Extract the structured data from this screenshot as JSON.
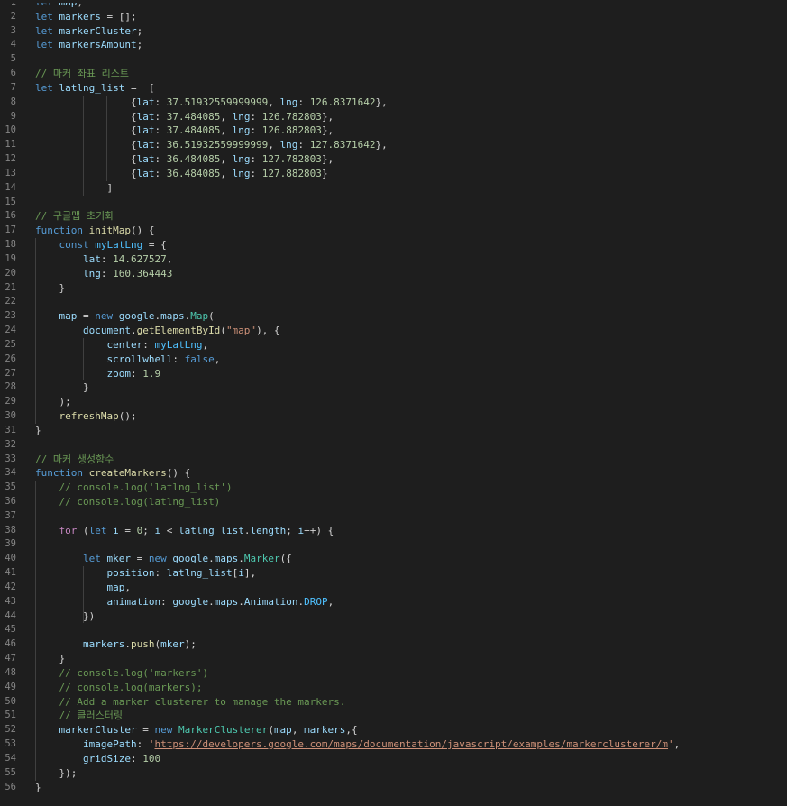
{
  "editor": {
    "language": "javascript",
    "theme": "dark",
    "first_line_number": 1,
    "lines": [
      [
        {
          "t": "let ",
          "c": "kw"
        },
        {
          "t": "map",
          "c": "var"
        },
        {
          "t": ";"
        }
      ],
      [
        {
          "t": "let ",
          "c": "kw"
        },
        {
          "t": "markers",
          "c": "var"
        },
        {
          "t": " = [];"
        }
      ],
      [
        {
          "t": "let ",
          "c": "kw"
        },
        {
          "t": "markerCluster",
          "c": "var"
        },
        {
          "t": ";"
        }
      ],
      [
        {
          "t": "let ",
          "c": "kw"
        },
        {
          "t": "markersAmount",
          "c": "var"
        },
        {
          "t": ";"
        }
      ],
      [],
      [
        {
          "t": "// 마커 좌표 리스트",
          "c": "cm"
        }
      ],
      [
        {
          "t": "let ",
          "c": "kw"
        },
        {
          "t": "latlng_list",
          "c": "var"
        },
        {
          "t": " =  ["
        }
      ],
      [
        {
          "t": "                {"
        },
        {
          "t": "lat",
          "c": "var"
        },
        {
          "t": ": "
        },
        {
          "t": "37.51932559999999",
          "c": "num"
        },
        {
          "t": ", "
        },
        {
          "t": "lng",
          "c": "var"
        },
        {
          "t": ": "
        },
        {
          "t": "126.8371642",
          "c": "num"
        },
        {
          "t": "},"
        }
      ],
      [
        {
          "t": "                {"
        },
        {
          "t": "lat",
          "c": "var"
        },
        {
          "t": ": "
        },
        {
          "t": "37.484085",
          "c": "num"
        },
        {
          "t": ", "
        },
        {
          "t": "lng",
          "c": "var"
        },
        {
          "t": ": "
        },
        {
          "t": "126.782803",
          "c": "num"
        },
        {
          "t": "},"
        }
      ],
      [
        {
          "t": "                {"
        },
        {
          "t": "lat",
          "c": "var"
        },
        {
          "t": ": "
        },
        {
          "t": "37.484085",
          "c": "num"
        },
        {
          "t": ", "
        },
        {
          "t": "lng",
          "c": "var"
        },
        {
          "t": ": "
        },
        {
          "t": "126.882803",
          "c": "num"
        },
        {
          "t": "},"
        }
      ],
      [
        {
          "t": "                {"
        },
        {
          "t": "lat",
          "c": "var"
        },
        {
          "t": ": "
        },
        {
          "t": "36.51932559999999",
          "c": "num"
        },
        {
          "t": ", "
        },
        {
          "t": "lng",
          "c": "var"
        },
        {
          "t": ": "
        },
        {
          "t": "127.8371642",
          "c": "num"
        },
        {
          "t": "},"
        }
      ],
      [
        {
          "t": "                {"
        },
        {
          "t": "lat",
          "c": "var"
        },
        {
          "t": ": "
        },
        {
          "t": "36.484085",
          "c": "num"
        },
        {
          "t": ", "
        },
        {
          "t": "lng",
          "c": "var"
        },
        {
          "t": ": "
        },
        {
          "t": "127.782803",
          "c": "num"
        },
        {
          "t": "},"
        }
      ],
      [
        {
          "t": "                {"
        },
        {
          "t": "lat",
          "c": "var"
        },
        {
          "t": ": "
        },
        {
          "t": "36.484085",
          "c": "num"
        },
        {
          "t": ", "
        },
        {
          "t": "lng",
          "c": "var"
        },
        {
          "t": ": "
        },
        {
          "t": "127.882803",
          "c": "num"
        },
        {
          "t": "}"
        }
      ],
      [
        {
          "t": "            ]"
        }
      ],
      [],
      [
        {
          "t": "// 구글맵 초기화",
          "c": "cm"
        }
      ],
      [
        {
          "t": "function ",
          "c": "kw"
        },
        {
          "t": "initMap",
          "c": "fn"
        },
        {
          "t": "() {"
        }
      ],
      [
        {
          "t": "    "
        },
        {
          "t": "const ",
          "c": "kw"
        },
        {
          "t": "myLatLng",
          "c": "const"
        },
        {
          "t": " = {"
        }
      ],
      [
        {
          "t": "        "
        },
        {
          "t": "lat",
          "c": "var"
        },
        {
          "t": ": "
        },
        {
          "t": "14.627527",
          "c": "num"
        },
        {
          "t": ","
        }
      ],
      [
        {
          "t": "        "
        },
        {
          "t": "lng",
          "c": "var"
        },
        {
          "t": ": "
        },
        {
          "t": "160.364443",
          "c": "num"
        }
      ],
      [
        {
          "t": "    }"
        }
      ],
      [],
      [
        {
          "t": "    "
        },
        {
          "t": "map",
          "c": "var"
        },
        {
          "t": " = "
        },
        {
          "t": "new ",
          "c": "kw"
        },
        {
          "t": "google",
          "c": "var"
        },
        {
          "t": "."
        },
        {
          "t": "maps",
          "c": "var"
        },
        {
          "t": "."
        },
        {
          "t": "Map",
          "c": "cls"
        },
        {
          "t": "("
        }
      ],
      [
        {
          "t": "        "
        },
        {
          "t": "document",
          "c": "var"
        },
        {
          "t": "."
        },
        {
          "t": "getElementById",
          "c": "fn"
        },
        {
          "t": "("
        },
        {
          "t": "\"map\"",
          "c": "str"
        },
        {
          "t": "), {"
        }
      ],
      [
        {
          "t": "            "
        },
        {
          "t": "center",
          "c": "var"
        },
        {
          "t": ": "
        },
        {
          "t": "myLatLng",
          "c": "const"
        },
        {
          "t": ","
        }
      ],
      [
        {
          "t": "            "
        },
        {
          "t": "scrollwhell",
          "c": "var"
        },
        {
          "t": ": "
        },
        {
          "t": "false",
          "c": "kw"
        },
        {
          "t": ","
        }
      ],
      [
        {
          "t": "            "
        },
        {
          "t": "zoom",
          "c": "var"
        },
        {
          "t": ": "
        },
        {
          "t": "1.9",
          "c": "num"
        }
      ],
      [
        {
          "t": "        }"
        }
      ],
      [
        {
          "t": "    );"
        }
      ],
      [
        {
          "t": "    "
        },
        {
          "t": "refreshMap",
          "c": "fn"
        },
        {
          "t": "();"
        }
      ],
      [
        {
          "t": "}"
        }
      ],
      [],
      [
        {
          "t": "// 마커 생성함수",
          "c": "cm"
        }
      ],
      [
        {
          "t": "function ",
          "c": "kw"
        },
        {
          "t": "createMarkers",
          "c": "fn"
        },
        {
          "t": "() {"
        }
      ],
      [
        {
          "t": "    "
        },
        {
          "t": "// console.log('latlng_list')",
          "c": "cm"
        }
      ],
      [
        {
          "t": "    "
        },
        {
          "t": "// console.log(latlng_list)",
          "c": "cm"
        }
      ],
      [],
      [
        {
          "t": "    "
        },
        {
          "t": "for ",
          "c": "ctl"
        },
        {
          "t": "("
        },
        {
          "t": "let ",
          "c": "kw"
        },
        {
          "t": "i",
          "c": "var"
        },
        {
          "t": " = "
        },
        {
          "t": "0",
          "c": "num"
        },
        {
          "t": "; "
        },
        {
          "t": "i",
          "c": "var"
        },
        {
          "t": " < "
        },
        {
          "t": "latlng_list",
          "c": "var"
        },
        {
          "t": "."
        },
        {
          "t": "length",
          "c": "var"
        },
        {
          "t": "; "
        },
        {
          "t": "i",
          "c": "var"
        },
        {
          "t": "++) {"
        }
      ],
      [],
      [
        {
          "t": "        "
        },
        {
          "t": "let ",
          "c": "kw"
        },
        {
          "t": "mker",
          "c": "var"
        },
        {
          "t": " = "
        },
        {
          "t": "new ",
          "c": "kw"
        },
        {
          "t": "google",
          "c": "var"
        },
        {
          "t": "."
        },
        {
          "t": "maps",
          "c": "var"
        },
        {
          "t": "."
        },
        {
          "t": "Marker",
          "c": "cls"
        },
        {
          "t": "({"
        }
      ],
      [
        {
          "t": "            "
        },
        {
          "t": "position",
          "c": "var"
        },
        {
          "t": ": "
        },
        {
          "t": "latlng_list",
          "c": "var"
        },
        {
          "t": "["
        },
        {
          "t": "i",
          "c": "var"
        },
        {
          "t": "],"
        }
      ],
      [
        {
          "t": "            "
        },
        {
          "t": "map",
          "c": "var"
        },
        {
          "t": ","
        }
      ],
      [
        {
          "t": "            "
        },
        {
          "t": "animation",
          "c": "var"
        },
        {
          "t": ": "
        },
        {
          "t": "google",
          "c": "var"
        },
        {
          "t": "."
        },
        {
          "t": "maps",
          "c": "var"
        },
        {
          "t": "."
        },
        {
          "t": "Animation",
          "c": "var"
        },
        {
          "t": "."
        },
        {
          "t": "DROP",
          "c": "const"
        },
        {
          "t": ","
        }
      ],
      [
        {
          "t": "        })"
        }
      ],
      [],
      [
        {
          "t": "        "
        },
        {
          "t": "markers",
          "c": "var"
        },
        {
          "t": "."
        },
        {
          "t": "push",
          "c": "fn"
        },
        {
          "t": "("
        },
        {
          "t": "mker",
          "c": "var"
        },
        {
          "t": ");"
        }
      ],
      [
        {
          "t": "    }"
        }
      ],
      [
        {
          "t": "    "
        },
        {
          "t": "// console.log('markers')",
          "c": "cm"
        }
      ],
      [
        {
          "t": "    "
        },
        {
          "t": "// console.log(markers);",
          "c": "cm"
        }
      ],
      [
        {
          "t": "    "
        },
        {
          "t": "// Add a marker clusterer to manage the markers.",
          "c": "cm"
        }
      ],
      [
        {
          "t": "    "
        },
        {
          "t": "// 클러스터링",
          "c": "cm"
        }
      ],
      [
        {
          "t": "    "
        },
        {
          "t": "markerCluster",
          "c": "var"
        },
        {
          "t": " = "
        },
        {
          "t": "new ",
          "c": "kw"
        },
        {
          "t": "MarkerClusterer",
          "c": "cls"
        },
        {
          "t": "("
        },
        {
          "t": "map",
          "c": "var"
        },
        {
          "t": ", "
        },
        {
          "t": "markers",
          "c": "var"
        },
        {
          "t": ",{"
        }
      ],
      [
        {
          "t": "        "
        },
        {
          "t": "imagePath",
          "c": "var"
        },
        {
          "t": ": "
        },
        {
          "t": "'",
          "c": "str"
        },
        {
          "t": "https://developers.google.com/maps/documentation/javascript/examples/markerclusterer/m",
          "c": "str url"
        },
        {
          "t": "'",
          "c": "str"
        },
        {
          "t": ","
        }
      ],
      [
        {
          "t": "        "
        },
        {
          "t": "gridSize",
          "c": "var"
        },
        {
          "t": ": "
        },
        {
          "t": "100",
          "c": "num"
        }
      ],
      [
        {
          "t": "    });"
        }
      ],
      [
        {
          "t": "}"
        }
      ]
    ]
  }
}
